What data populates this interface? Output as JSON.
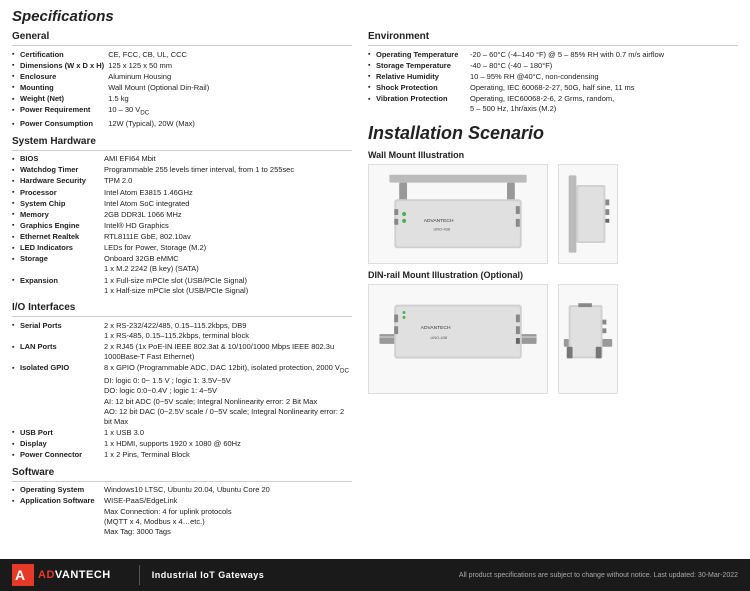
{
  "page": {
    "title": "Specifications"
  },
  "left": {
    "sections": [
      {
        "id": "general",
        "title": "General",
        "rows": [
          {
            "label": "Certification",
            "value": "CE, FCC, CB, UL, CCC"
          },
          {
            "label": "Dimensions (W x D x H)",
            "value": "125 x 125 x 50 mm"
          },
          {
            "label": "Enclosure",
            "value": "Aluminum Housing"
          },
          {
            "label": "Mounting",
            "value": "Wall Mount (Optional Din-Rail)"
          },
          {
            "label": "Weight (Net)",
            "value": "1.5 kg"
          },
          {
            "label": "Power Requirement",
            "value": "10 – 30 VDC"
          },
          {
            "label": "Power Consumption",
            "value": "12W (Typical), 20W (Max)"
          }
        ]
      },
      {
        "id": "system-hardware",
        "title": "System Hardware",
        "rows": [
          {
            "label": "BIOS",
            "value": "AMI EFI64 Mbit"
          },
          {
            "label": "Watchdog Timer",
            "value": "Programmable 255 levels timer interval, from 1 to 255sec"
          },
          {
            "label": "Hardware Security",
            "value": "TPM 2.0"
          },
          {
            "label": "Processor",
            "value": "Intel Atom E3815 1.46GHz"
          },
          {
            "label": "System Chip",
            "value": "Intel Atom SoC integrated"
          },
          {
            "label": "Memory",
            "value": "2GB DDR3L 1066 MHz"
          },
          {
            "label": "Graphics Engine",
            "value": "Intel® HD Graphics"
          },
          {
            "label": "Ethernet Realtek",
            "value": "RTL8111E GbE, 802.10av"
          },
          {
            "label": "LED Indicators",
            "value": "LEDs for Power, Storage (M.2)"
          },
          {
            "label": "Storage",
            "value": "Onboard 32GB eMMC\n1 x M.2 2242 (B key) (SATA)\n1 x Full-size mPCIe slot (USB/PCIe Signal)\n1 x Half-size mPCIe slot (USB/PCIe Signal)"
          },
          {
            "label": "Expansion",
            "value": ""
          }
        ]
      },
      {
        "id": "io-interfaces",
        "title": "I/O Interfaces",
        "rows": [
          {
            "label": "Serial Ports",
            "value": "2 x RS-232/422/485, 0.15–115.2kbps, DB9\n1 x RS-485, 0.15–115.2kbps, terminal block"
          },
          {
            "label": "LAN Ports",
            "value": "2 x RJ45 (1x PoE-IN IEEE 802.3at & 10/100/1000 Mbps IEEE 802.3u 1000Base-T Fast Ethernet)"
          },
          {
            "label": "Isolated GPIO",
            "value": "8 x GPIO (Programmable ADC, DAC 12bit), isolated protection, 2000 VDC\nDI: logic 0: 0~ 1.5 V ; logic 1: 3.5V~5V\nDO: logic 0:0~0.4V ; logic 1: 4~5V\nAI: 12 bit ADC (0~5V scale; Integral Nonlinearity error: 2 Bit Max\nAO: 12 bit DAC (0~2.5V scale / 0~5V scale; Integral Nonlinearity error: 2 bit Max"
          },
          {
            "label": "USB Port",
            "value": "1 x USB 3.0"
          },
          {
            "label": "Display",
            "value": "1 x HDMI, supports 1920 x 1080 @ 60Hz"
          },
          {
            "label": "Power Connector",
            "value": "1 x 2 Pins, Terminal Block"
          }
        ]
      },
      {
        "id": "software",
        "title": "Software",
        "rows": [
          {
            "label": "Operating System",
            "value": "Windows10 LTSC, Ubuntu 20.04, Ubuntu Core 20"
          },
          {
            "label": "Application Software",
            "value": "WISE-PaaS/EdgeLink\nMax Connection: 4 for uplink protocols\n(MQTT x 4, Modbus x 4…etc.)\nMax Tag: 3000 Tags"
          }
        ]
      }
    ]
  },
  "right": {
    "environment": {
      "title": "Environment",
      "rows": [
        {
          "label": "Operating Temperature",
          "value": "-20 – 60°C (-4–140 °F) @ 5 – 85% RH with 0.7 m/s airflow"
        },
        {
          "label": "Storage Temperature",
          "value": "-40 – 80°C (-40 – 180°F)"
        },
        {
          "label": "Relative Humidity",
          "value": "10 – 95% RH @40°C, non-condensing"
        },
        {
          "label": "Shock Protection",
          "value": "Operating, IEC 60068-2-27, 50G, half sine, 11 ms"
        },
        {
          "label": "Vibration Protection",
          "value": "Operating, IEC60068-2-6, 2 Grms, random,\n5 – 500 Hz, 1hr/axis (M.2)"
        }
      ]
    },
    "installation": {
      "title": "Installation Scenario",
      "wallMount": {
        "title": "Wall Mount Illustration"
      },
      "dinRail": {
        "title": "DIN-rail Mount Illustration (Optional)"
      }
    }
  },
  "footer": {
    "logo_adv": "AD",
    "logo_antech": "VANTECH",
    "logo_symbol": "■",
    "divider": "|",
    "tagline": "Industrial IoT Gateways",
    "note": "All product specifications are subject to change without notice.",
    "updated": "Last updated: 30-Mar-2022"
  }
}
